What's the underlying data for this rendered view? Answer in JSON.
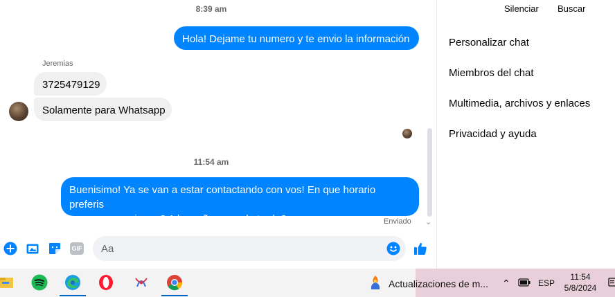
{
  "chat": {
    "timestamp_1": "8:39 am",
    "outgoing_1": "Hola! Dejame tu numero y te envio la información",
    "sender_name": "Jeremias",
    "incoming_1": "3725479129",
    "incoming_2": "Solamente para Whatsapp",
    "timestamp_2": "11:54 am",
    "outgoing_2_line1": "Buenisimo! Ya se van a estar contactando con vos! En que horario preferis",
    "outgoing_2_line2": "que se comuniquen? A la mañana o a la tarde?",
    "status": "Enviado"
  },
  "composer": {
    "placeholder": "Aa",
    "icons": [
      "plus-circle-icon",
      "image-icon",
      "sticker-icon",
      "gif-icon",
      "emoji-icon",
      "thumbs-up-icon"
    ],
    "gif_label": "GIF",
    "accent": "#0084ff"
  },
  "sidebar": {
    "top_actions": [
      "Silenciar",
      "Buscar"
    ],
    "items": [
      "Personalizar chat",
      "Miembros del chat",
      "Multimedia, archivos y enlaces",
      "Privacidad y ayuda"
    ]
  },
  "taskbar": {
    "apps": [
      "file-explorer-icon",
      "spotify-icon",
      "edge-icon",
      "opera-icon",
      "app-icon",
      "chrome-icon"
    ],
    "notification": "Actualizaciones de m...",
    "language": "ESP",
    "time": "11:54",
    "date": "5/8/2024"
  }
}
